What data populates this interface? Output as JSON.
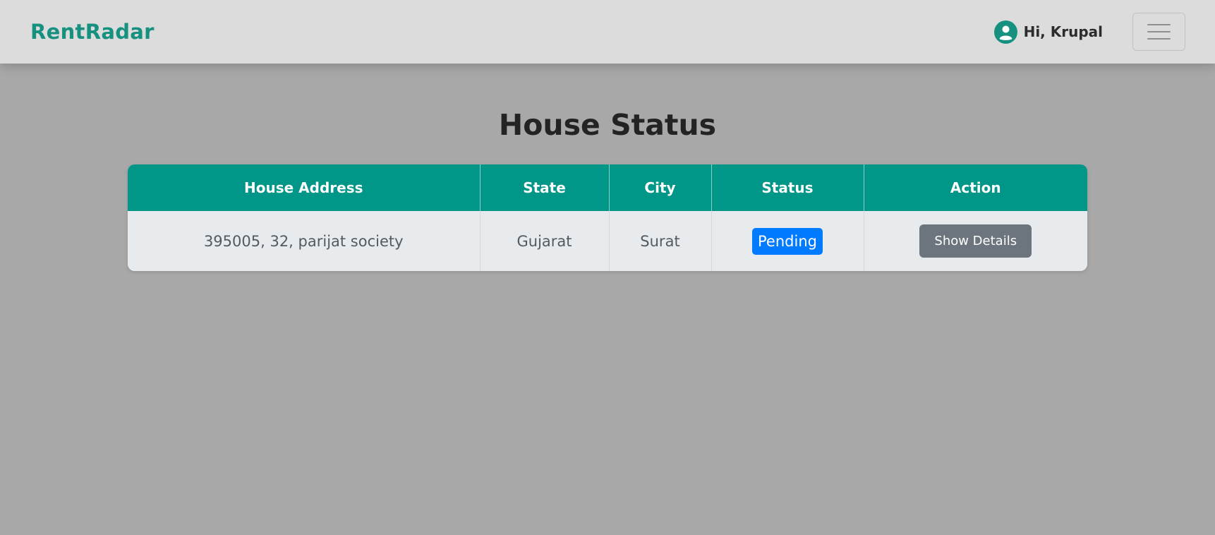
{
  "brand": {
    "name": "RentRadar",
    "color": "#17917f"
  },
  "nav": {
    "greeting": "Hi, Krupal",
    "avatar_icon": "user-circle-icon",
    "menu_icon": "hamburger-icon"
  },
  "page": {
    "title": "House Status"
  },
  "table": {
    "headers": [
      "House Address",
      "State",
      "City",
      "Status",
      "Action"
    ],
    "rows": [
      {
        "address": "395005, 32, parijat society",
        "state": "Gujarat",
        "city": "Surat",
        "status": "Pending",
        "action": "Show Details"
      }
    ]
  },
  "colors": {
    "header_bg": "#009688",
    "status_pending": "#007bff",
    "action_button": "#6c757d",
    "overlay_bg": "#a8a8a8"
  }
}
